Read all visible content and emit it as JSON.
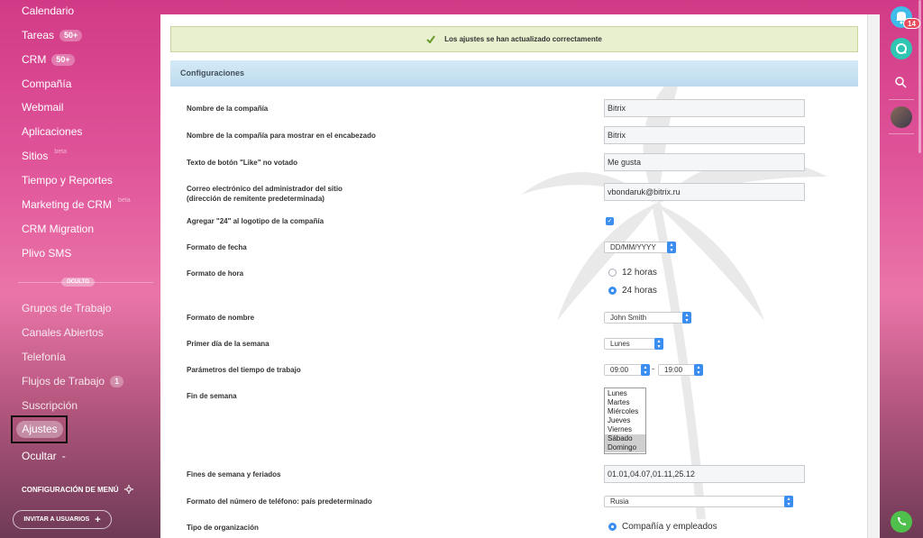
{
  "sidebar": {
    "items": [
      {
        "label": "Calendario",
        "counter": ""
      },
      {
        "label": "Tareas",
        "counter": "50+"
      },
      {
        "label": "CRM",
        "counter": "50+"
      },
      {
        "label": "Compañía",
        "counter": ""
      },
      {
        "label": "Webmail",
        "counter": ""
      },
      {
        "label": "Aplicaciones",
        "counter": ""
      },
      {
        "label": "Sitios",
        "sup": "beta"
      },
      {
        "label": "Tiempo y Reportes",
        "counter": ""
      },
      {
        "label": "Marketing de CRM",
        "sup": "beta"
      },
      {
        "label": "CRM Migration",
        "counter": ""
      },
      {
        "label": "Plivo SMS",
        "counter": ""
      }
    ],
    "hidden_label": "OCULTO",
    "hidden_items": [
      {
        "label": "Grupos de Trabajo"
      },
      {
        "label": "Canales Abiertos"
      },
      {
        "label": "Telefonía"
      },
      {
        "label": "Flujos de Trabajo",
        "counter": "1"
      },
      {
        "label": "Suscripción"
      }
    ],
    "active_item": "Ajustes",
    "hide_label": "Ocultar",
    "menu_settings": "CONFIGURACIÓN DE MENÚ",
    "invite_button": "INVITAR A USUARIOS"
  },
  "main": {
    "success_message": "Los ajustes se han actualizado correctamente",
    "section_title": "Configuraciones",
    "fields": {
      "company_name_label": "Nombre de la compañía",
      "company_name_value": "Bitrix",
      "company_header_label": "Nombre de la compañía para mostrar en el encabezado",
      "company_header_value": "Bitrix",
      "like_label": "Texto de botón \"Like\" no votado",
      "like_value": "Me gusta",
      "email_label_1": "Correo electrónico del administrador del sitio",
      "email_label_2": "(dirección de remitente predeterminada)",
      "email_value": "vbondaruk@bitrix.ru",
      "logo24_label": "Agregar \"24\" al logotipo de la compañía",
      "date_format_label": "Formato de fecha",
      "date_format_value": "DD/MM/YYYY",
      "time_format_label": "Formato de hora",
      "time_12": "12 horas",
      "time_24": "24 horas",
      "name_format_label": "Formato de nombre",
      "name_format_value": "John Smith",
      "first_day_label": "Primer día de la semana",
      "first_day_value": "Lunes",
      "work_time_label": "Parámetros del tiempo de trabajo",
      "work_start": "09:00",
      "work_end": "19:00",
      "weekend_label": "Fin de semana",
      "weekdays": [
        "Lunes",
        "Martes",
        "Miércoles",
        "Jueves",
        "Viernes",
        "Sábado",
        "Domingo"
      ],
      "holidays_label": "Fines de semana y feriados",
      "holidays_value": "01.01,04.07,01.11,25.12",
      "phone_label": "Formato del número de teléfono: país predeterminado",
      "phone_value": "Rusia",
      "org_type_label": "Tipo de organización",
      "org_type_value": "Compañía y empleados"
    }
  },
  "rightbar": {
    "notification_count": "14"
  },
  "colors": {
    "accent": "#3b8ef0",
    "success_bg": "#e8f0cf",
    "section_header": "#cfe6f5",
    "notification_badge": "#e84c5c",
    "phone_green": "#4fc04c",
    "chat_teal": "#2fc6b4"
  }
}
